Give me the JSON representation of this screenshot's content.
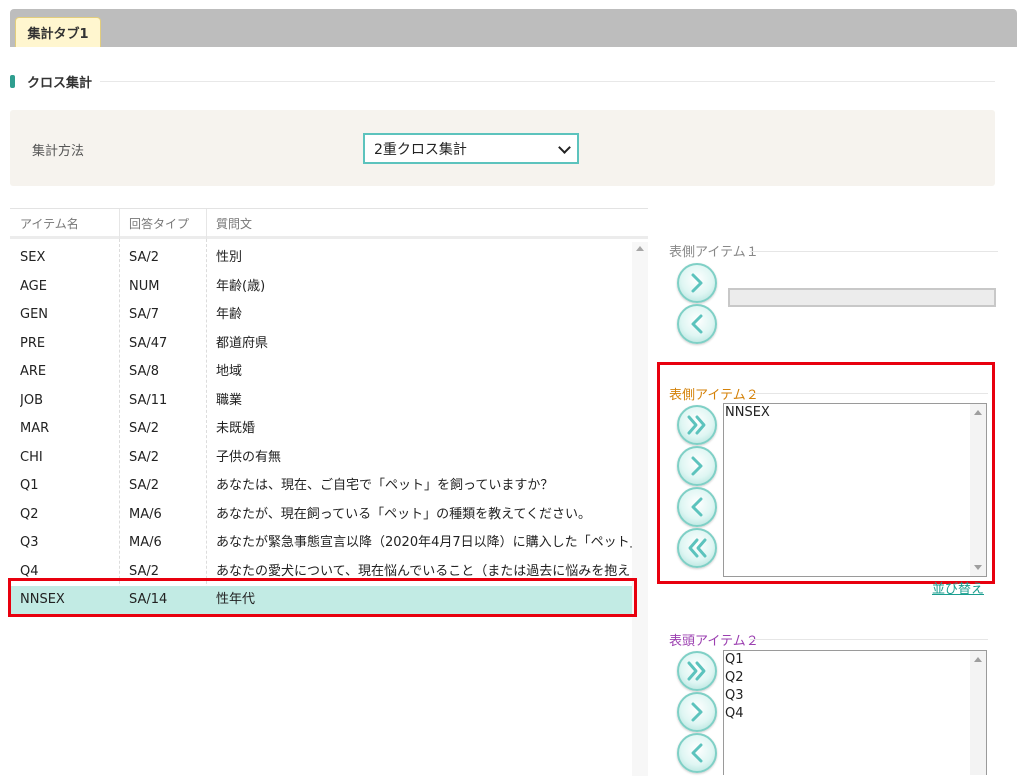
{
  "tabs": [
    {
      "label": "集計タブ1",
      "active": true
    }
  ],
  "section": {
    "title": "クロス集計"
  },
  "method": {
    "label": "集計方法",
    "selected": "2重クロス集計"
  },
  "table": {
    "headers": [
      "アイテム名",
      "回答タイプ",
      "質問文"
    ],
    "rows": [
      {
        "name": "SEX",
        "type": "SA/2",
        "question": "性別"
      },
      {
        "name": "AGE",
        "type": "NUM",
        "question": "年齢(歳)"
      },
      {
        "name": "GEN",
        "type": "SA/7",
        "question": "年齢"
      },
      {
        "name": "PRE",
        "type": "SA/47",
        "question": "都道府県"
      },
      {
        "name": "ARE",
        "type": "SA/8",
        "question": "地域"
      },
      {
        "name": "JOB",
        "type": "SA/11",
        "question": "職業"
      },
      {
        "name": "MAR",
        "type": "SA/2",
        "question": "未既婚"
      },
      {
        "name": "CHI",
        "type": "SA/2",
        "question": "子供の有無"
      },
      {
        "name": "Q1",
        "type": "SA/2",
        "question": "あなたは、現在、ご自宅で「ペット」を飼っていますか？"
      },
      {
        "name": "Q2",
        "type": "MA/6",
        "question": "あなたが、現在飼っている「ペット」の種類を教えてください。"
      },
      {
        "name": "Q3",
        "type": "MA/6",
        "question": "あなたが緊急事態宣言以降（2020年4月7日以降）に購入した「ペット」"
      },
      {
        "name": "Q4",
        "type": "SA/2",
        "question": "あなたの愛犬について、現在悩んでいること（または過去に悩みを抱え"
      },
      {
        "name": "NNSEX",
        "type": "SA/14",
        "question": "性年代"
      }
    ],
    "selected_index": 12
  },
  "panel": {
    "side_item1": {
      "label": "表側アイテム１",
      "items": []
    },
    "side_item2": {
      "label": "表側アイテム２",
      "items": [
        "NNSEX"
      ]
    },
    "head_item2": {
      "label": "表頭アイテム２",
      "items": [
        "Q1",
        "Q2",
        "Q3",
        "Q4"
      ]
    },
    "sort_link": "並び替え"
  },
  "colors": {
    "accent": "#5cc3bd",
    "highlight": "#e8000e",
    "selected_row": "#c2ebe4"
  }
}
